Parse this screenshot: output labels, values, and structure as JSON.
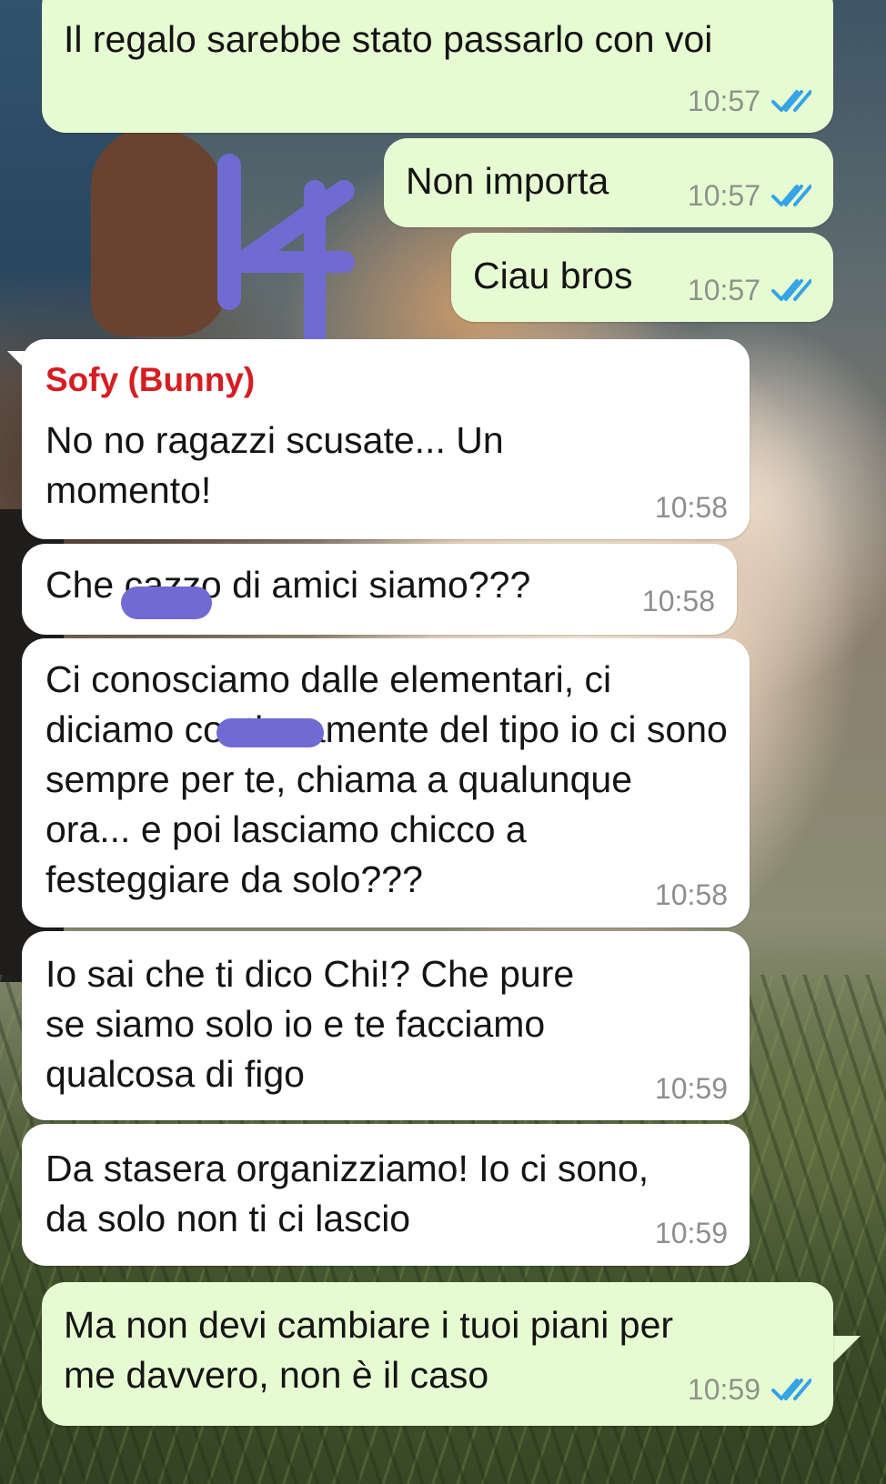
{
  "colors": {
    "outgoing_bubble": "#e7fbd3",
    "incoming_bubble": "#ffffff",
    "sender_name": "#d61d22",
    "read_ticks": "#34a4e6",
    "timestamp": "#8d9389",
    "overlay_marker": "#6f6bd2"
  },
  "overlay": {
    "label": "14"
  },
  "messages": [
    {
      "text": "Il regalo sarebbe stato passarlo con voi",
      "time": "10:57",
      "icon": "double-check-read-icon"
    },
    {
      "text": "Non importa",
      "time": "10:57",
      "icon": "double-check-read-icon"
    },
    {
      "text": "Ciau bros",
      "time": "10:57",
      "icon": "double-check-read-icon"
    },
    {
      "sender": "Sofy (Bunny)",
      "text": "No no ragazzi scusate... Un\nmomento!",
      "time": "10:58"
    },
    {
      "text": "Che cazzo di amici siamo???",
      "time": "10:58"
    },
    {
      "text": "Ci conosciamo dalle elementari, ci\ndiciamo continuamente del tipo io ci sono\nsempre per te, chiama a qualunque\nora... e poi lasciamo chicco a\nfesteggiare da solo???",
      "time": "10:58"
    },
    {
      "text": "Io sai che ti dico Chi!? Che pure\nse siamo solo io e te facciamo\nqualcosa di figo",
      "time": "10:59"
    },
    {
      "text": "Da stasera organizziamo! Io ci sono,\nda solo non ti ci lascio",
      "time": "10:59"
    },
    {
      "text": "Ma non devi cambiare i tuoi piani per\nme davvero, non è il caso",
      "time": "10:59",
      "icon": "double-check-read-icon"
    }
  ]
}
